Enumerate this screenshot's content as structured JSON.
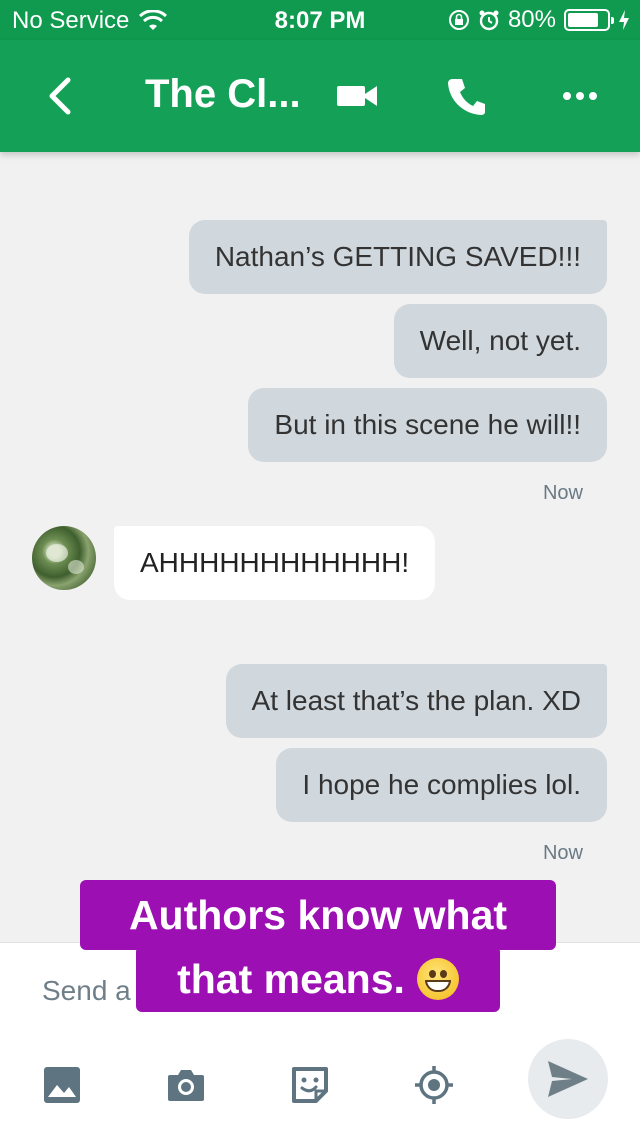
{
  "status_bar": {
    "carrier": "No Service",
    "time": "8:07 PM",
    "battery": "80%",
    "battery_level": 0.8
  },
  "header": {
    "title": "The Cl..."
  },
  "messages": [
    {
      "direction": "out",
      "text": "Nathan’s GETTING SAVED!!!"
    },
    {
      "direction": "out",
      "text": "Well, not yet."
    },
    {
      "direction": "out",
      "text": "But in this scene he will!!"
    },
    {
      "type": "timestamp",
      "text": "Now"
    },
    {
      "direction": "in",
      "text": "AHHHHHHHHHHHH!"
    },
    {
      "direction": "out",
      "text": "At least that’s the plan. XD"
    },
    {
      "direction": "out",
      "text": "I hope he complies lol."
    },
    {
      "type": "timestamp",
      "text": "Now"
    }
  ],
  "composer": {
    "placeholder": "Send a"
  },
  "overlay_caption": {
    "line1": "Authors know what",
    "line2": "that means."
  },
  "colors": {
    "status_bar": "#0f9a4f",
    "app_bar": "#14a157",
    "outgoing_bubble": "#d0d8de",
    "incoming_bubble": "#ffffff",
    "caption_bg": "#9c0fb3"
  },
  "icons": [
    "wifi-icon",
    "orientation-lock-icon",
    "alarm-icon",
    "battery-icon",
    "charging-icon",
    "back-icon",
    "video-call-icon",
    "phone-icon",
    "more-icon",
    "gallery-icon",
    "camera-icon",
    "sticker-icon",
    "location-icon",
    "send-icon",
    "grinning-emoji-icon"
  ]
}
